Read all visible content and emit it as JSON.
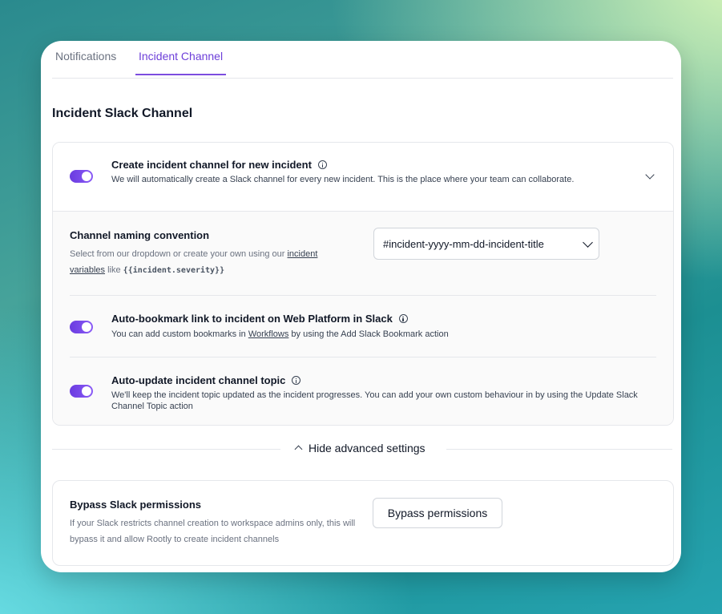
{
  "tabs": [
    {
      "label": "Notifications",
      "active": false
    },
    {
      "label": "Incident Channel",
      "active": true
    }
  ],
  "section_title": "Incident Slack Channel",
  "create_channel": {
    "enabled": true,
    "title": "Create incident channel for new incident",
    "description": "We will automatically create a Slack channel for every new incident. This is the place where your team can collaborate."
  },
  "naming": {
    "title": "Channel naming convention",
    "desc_prefix": "Select from our dropdown or create your own using our",
    "link_incident": "incident",
    "link_variables": "variables",
    "desc_like": "like",
    "code": "{{incident.severity}}",
    "selected_value": "#incident-yyyy-mm-dd-incident-title"
  },
  "auto_bookmark": {
    "enabled": true,
    "title": "Auto-bookmark link to incident on Web Platform in Slack",
    "desc_prefix": "You can add custom bookmarks in",
    "link": "Workflows",
    "desc_suffix": "by using the Add Slack Bookmark action"
  },
  "auto_update": {
    "enabled": true,
    "title": "Auto-update incident channel topic",
    "description": "We'll keep the incident topic updated as the incident progresses. You can add your own custom behaviour in by using the Update Slack Channel Topic action"
  },
  "advanced_toggle_label": "Hide advanced settings",
  "bypass": {
    "title": "Bypass Slack permissions",
    "description": "If your Slack restricts channel creation to workspace admins only, this will bypass it and allow Rootly to create incident channels",
    "button_label": "Bypass permissions"
  },
  "colors": {
    "accent": "#7c4ddf",
    "toggle_on": "#6a3be0"
  }
}
